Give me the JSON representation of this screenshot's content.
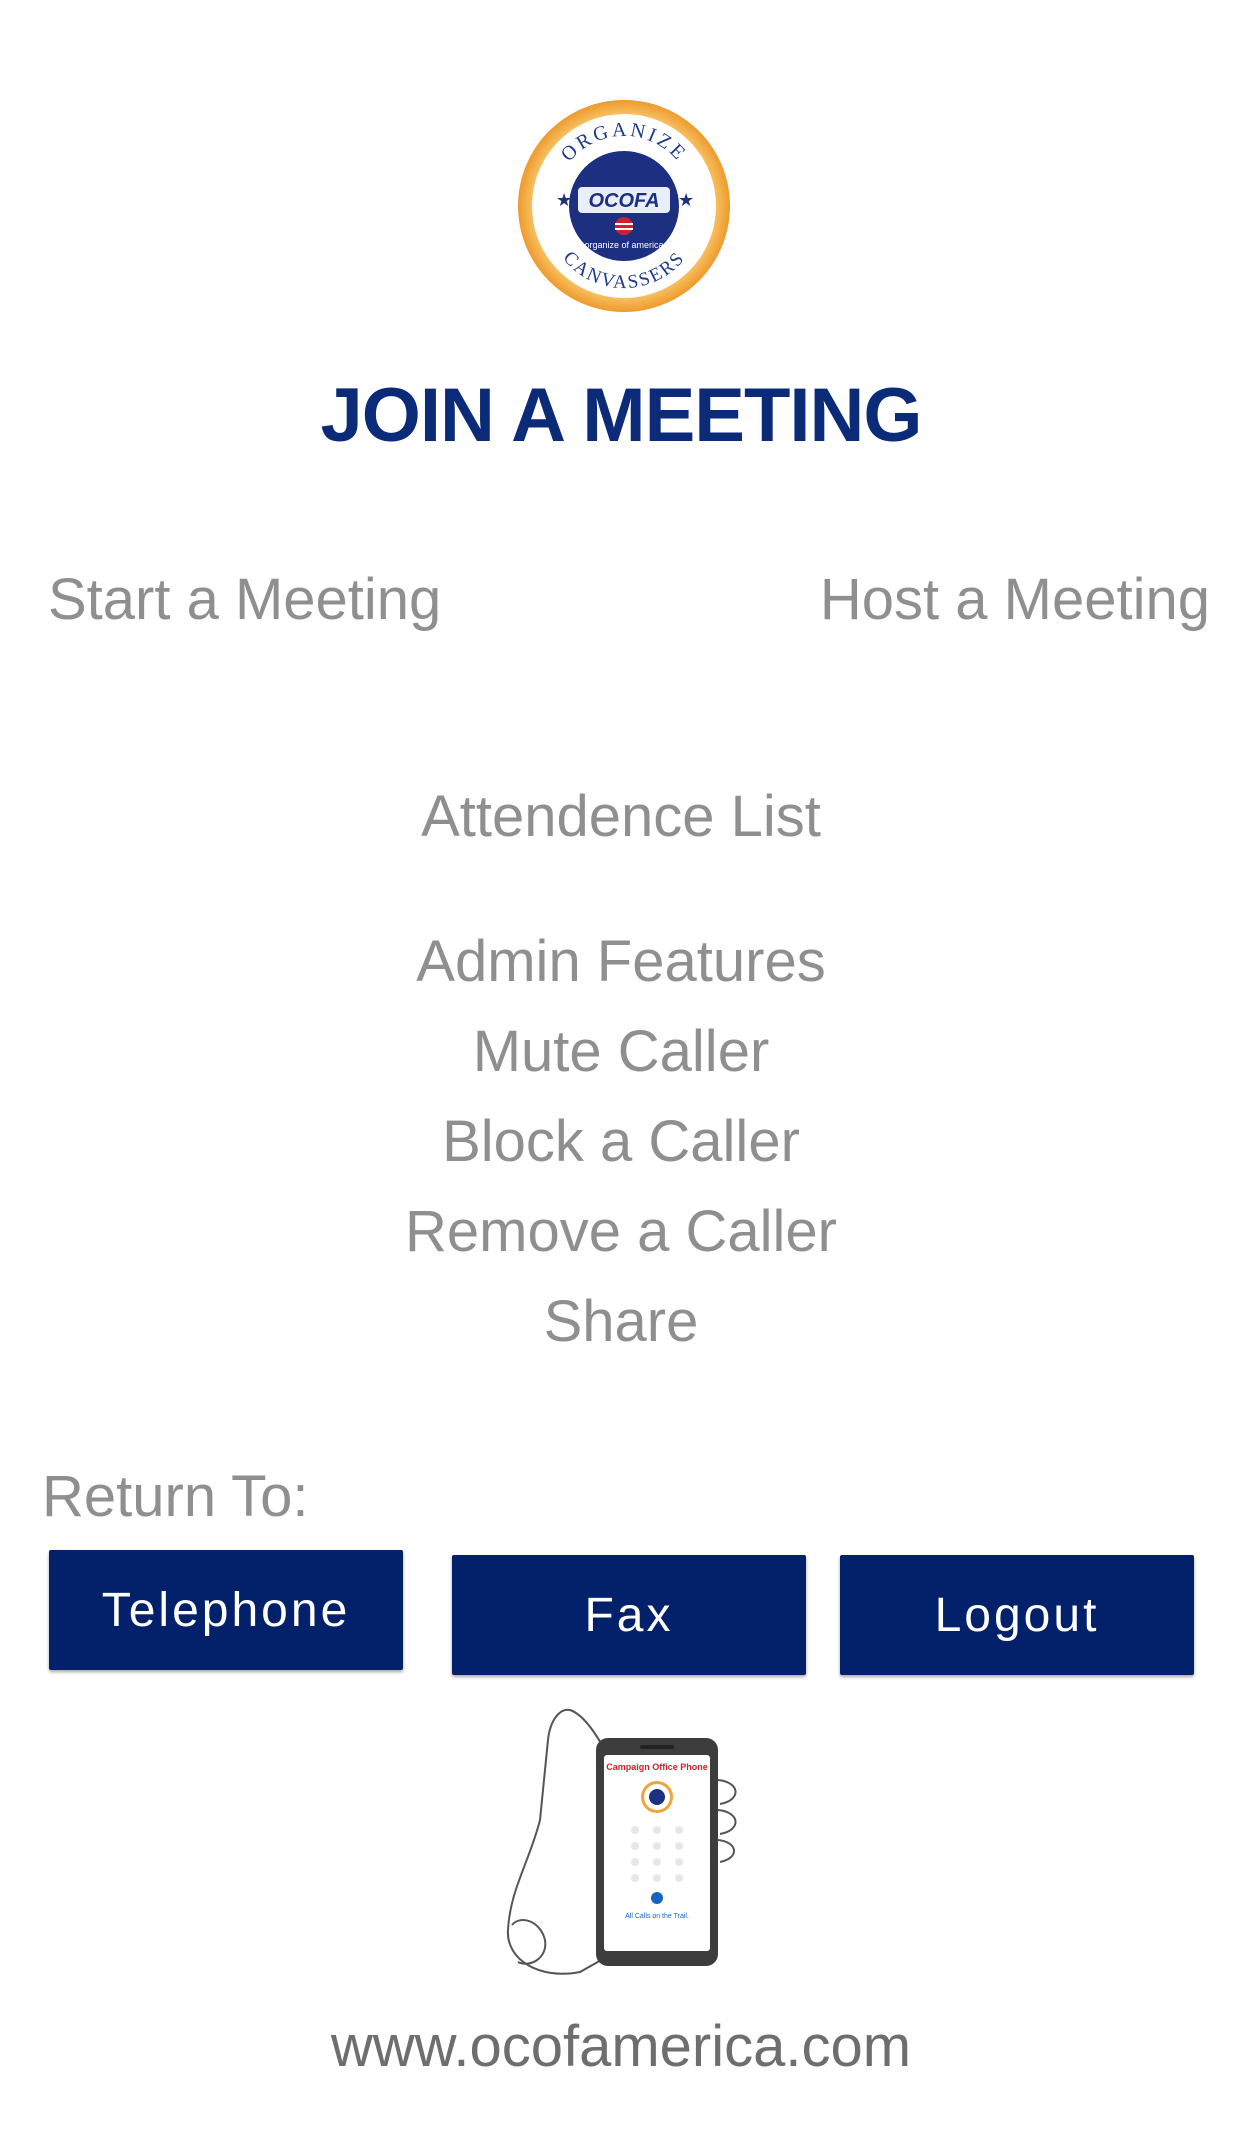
{
  "logo": {
    "ring_top_text": "ORGANIZE",
    "ring_bottom_text": "CANVASSERS",
    "center_text": "OCOFA",
    "sub_text": "organize of america"
  },
  "title": "JOIN A MEETING",
  "options": {
    "start_meeting": "Start a Meeting",
    "host_meeting": "Host a Meeting",
    "attendence_list": "Attendence List"
  },
  "admin": {
    "heading": "Admin Features",
    "items": [
      "Mute Caller",
      "Block a Caller",
      "Remove a Caller",
      "Share"
    ]
  },
  "return_to": {
    "label": "Return To:",
    "buttons": [
      "Telephone",
      "Fax",
      "Logout"
    ]
  },
  "phone_illustration": {
    "screen_title": "Campaign Office Phone",
    "screen_footer": "All Calls on the Trail."
  },
  "footer": {
    "website": "www.ocofamerica.com"
  },
  "colors": {
    "brand_blue": "#03206b",
    "title_blue": "#0b2a78",
    "link_gray": "#8f8f8f",
    "logo_orange": "#f2a33a",
    "logo_red": "#d0202e"
  }
}
